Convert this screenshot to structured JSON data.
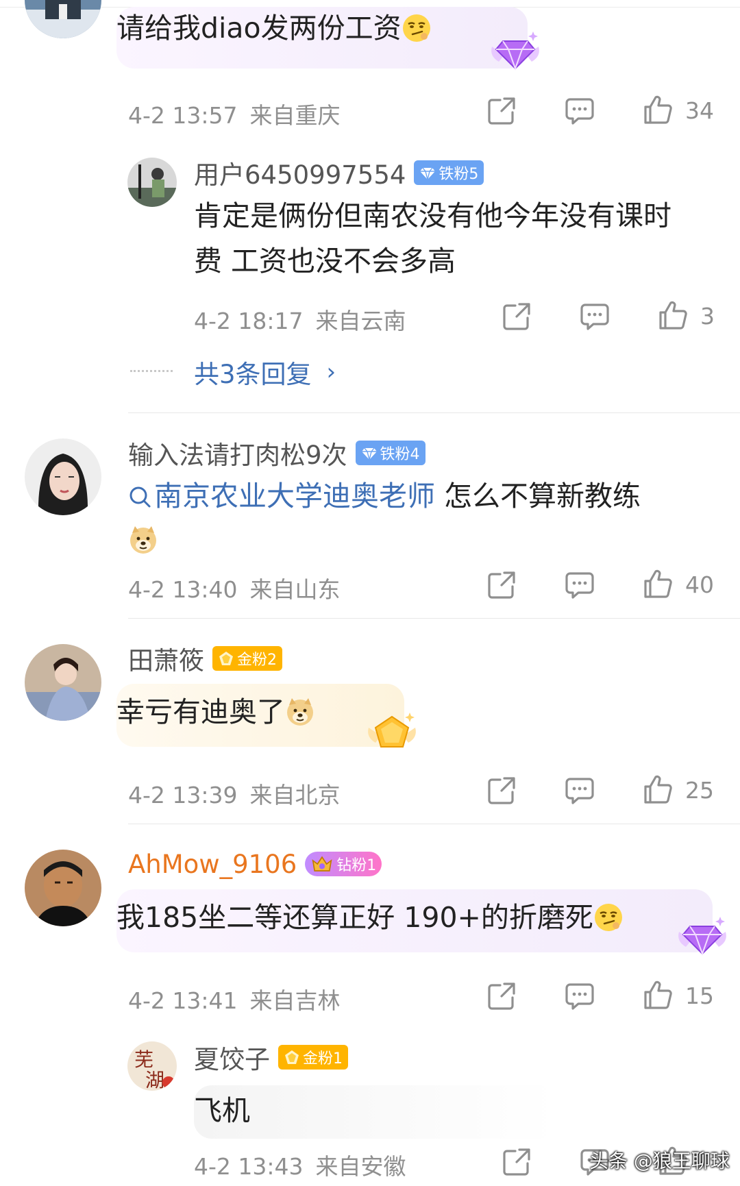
{
  "comments": [
    {
      "text": "请给我diao发两份工资",
      "emoji": "smirk-face-emoji",
      "badge_icon": "purple-gem-icon",
      "time": "4-2 13:57",
      "location": "来自重庆",
      "likes": "34",
      "reply": {
        "username": "用户6450997554",
        "badge": "铁粉5",
        "text": "肯定是俩份但南农没有他今年没有课时费 工资也没不会多高",
        "time": "4-2 18:17",
        "location": "来自云南",
        "likes": "3",
        "more": "共3条回复"
      }
    },
    {
      "username": "输入法请打肉松9次",
      "badge": "铁粉4",
      "search_link": "南京农业大学迪奥老师",
      "text_after_link": " 怎么不算新教练",
      "emoji": "doge-emoji",
      "time": "4-2 13:40",
      "location": "来自山东",
      "likes": "40"
    },
    {
      "username": "田萧筱",
      "badge": "金粉2",
      "text": "幸亏有迪奥了",
      "emoji": "doge-emoji",
      "badge_icon": "gold-gem-icon",
      "time": "4-2 13:39",
      "location": "来自北京",
      "likes": "25"
    },
    {
      "username": "AhMow_9106",
      "badge": "钻粉1",
      "text": "我185坐二等还算正好 190+的折磨死",
      "emoji": "smirk-face-emoji",
      "badge_icon": "purple-gem-icon",
      "time": "4-2 13:41",
      "location": "来自吉林",
      "likes": "15",
      "reply": {
        "username": "夏饺子",
        "badge": "金粉1",
        "text": "飞机",
        "time": "4-2 13:43",
        "location": "来自安徽"
      }
    }
  ],
  "watermark": "头条 @狼王聊球",
  "colors": {
    "link": "#3e6fb5",
    "meta": "#8f8f8f",
    "badge_blue": "#6aa3f3",
    "badge_gold": "#ffb400",
    "username_orange": "#e9761f"
  }
}
